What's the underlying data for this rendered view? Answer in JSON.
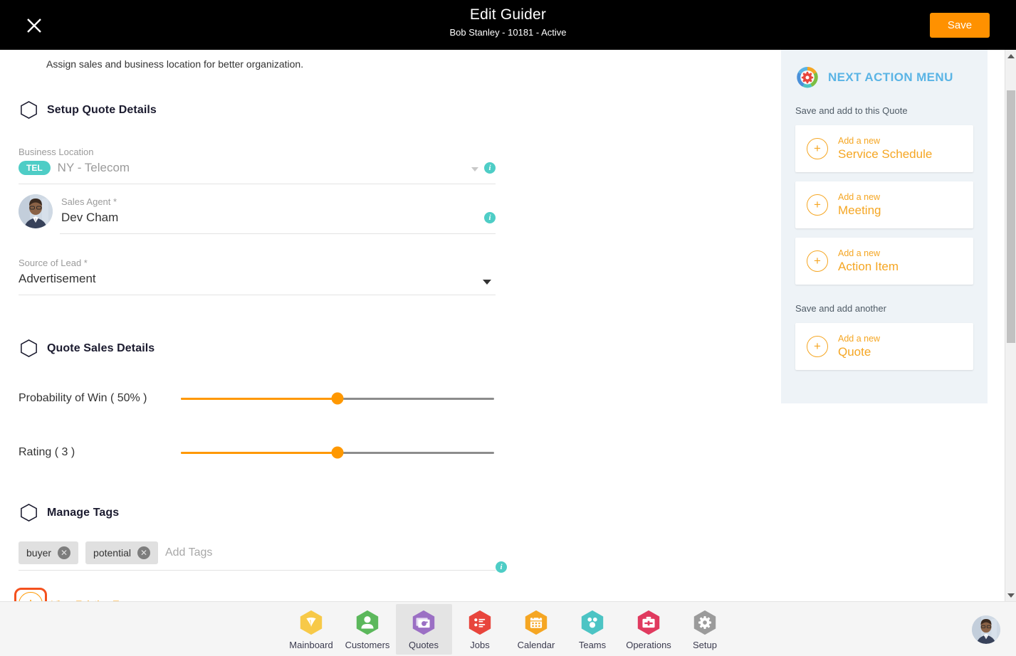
{
  "header": {
    "close_icon": "close-icon",
    "title": "Edit Guider",
    "subtitle": "Bob Stanley - 10181 - Active",
    "save_label": "Save",
    "save_color": "#FF9100",
    "bg_color": "#000000"
  },
  "form": {
    "intro": "Assign sales and business location for better organization.",
    "sections": [
      {
        "title": "Setup Quote Details"
      },
      {
        "title": "Quote Sales Details"
      },
      {
        "title": "Manage Tags"
      }
    ],
    "business_location": {
      "label": "Business Location",
      "badge": "TEL",
      "badge_color": "#4ECDC6",
      "value": "NY - Telecom",
      "dropdown_icon": "chevron-down-icon",
      "info_icon": "info-icon"
    },
    "sales_agent": {
      "label": "Sales Agent *",
      "value": "Dev Cham",
      "avatar": "avatar",
      "info_icon": "info-icon"
    },
    "source_of_lead": {
      "label": "Source of Lead *",
      "value": "Advertisement",
      "dropdown_icon": "chevron-down-icon"
    },
    "sliders": [
      {
        "label": "Probability of Win ( 50% )",
        "value": 50,
        "min": 0,
        "max": 100,
        "fill_color": "#FF9800"
      },
      {
        "label": "Rating ( 3 )",
        "value": 50,
        "min": 0,
        "max": 100,
        "fill_color": "#FF9800"
      }
    ],
    "tags": {
      "chips": [
        {
          "label": "buyer",
          "remove_icon": "close-circle-icon"
        },
        {
          "label": "potential",
          "remove_icon": "close-circle-icon"
        }
      ],
      "input_placeholder": "Add Tags",
      "info_icon": "info-icon",
      "view_existing_label": "View Existing Tags",
      "plus_icon": "plus-circle-icon",
      "focus_color": "#F4511E"
    }
  },
  "next_action_menu": {
    "icon": "color-gear-icon",
    "title": "NEXT ACTION MENU",
    "title_color": "#5AB4E5",
    "group1_label": "Save and add to this Quote",
    "group1_items": [
      {
        "top": "Add a new",
        "main": "Service Schedule",
        "icon": "plus-circle-icon"
      },
      {
        "top": "Add a new",
        "main": "Meeting",
        "icon": "plus-circle-icon"
      },
      {
        "top": "Add a new",
        "main": "Action Item",
        "icon": "plus-circle-icon"
      }
    ],
    "group2_label": "Save and add another",
    "group2_items": [
      {
        "top": "Add a new",
        "main": "Quote",
        "icon": "plus-circle-icon"
      }
    ],
    "accent_color": "#F5A623",
    "bg_color": "#eef3f7"
  },
  "scrollbar": {
    "up_icon": "scroll-up-arrow-icon",
    "down_icon": "scroll-down-arrow-icon"
  },
  "bottom_nav": {
    "items": [
      {
        "label": "Mainboard",
        "icon": "mainboard-hex-icon",
        "color": "#F7C948",
        "active": false
      },
      {
        "label": "Customers",
        "icon": "customers-hex-icon",
        "color": "#5CB85C",
        "active": false
      },
      {
        "label": "Quotes",
        "icon": "quotes-hex-icon",
        "color": "#9B6FC4",
        "active": true
      },
      {
        "label": "Jobs",
        "icon": "jobs-hex-icon",
        "color": "#E8453C",
        "active": false
      },
      {
        "label": "Calendar",
        "icon": "calendar-hex-icon",
        "color": "#F5A623",
        "active": false
      },
      {
        "label": "Teams",
        "icon": "teams-hex-icon",
        "color": "#4CC4C4",
        "active": false
      },
      {
        "label": "Operations",
        "icon": "operations-hex-icon",
        "color": "#E03A5F",
        "active": false
      },
      {
        "label": "Setup",
        "icon": "setup-hex-icon",
        "color": "#9B9B9B",
        "active": false
      }
    ],
    "avatar": "user-avatar"
  }
}
